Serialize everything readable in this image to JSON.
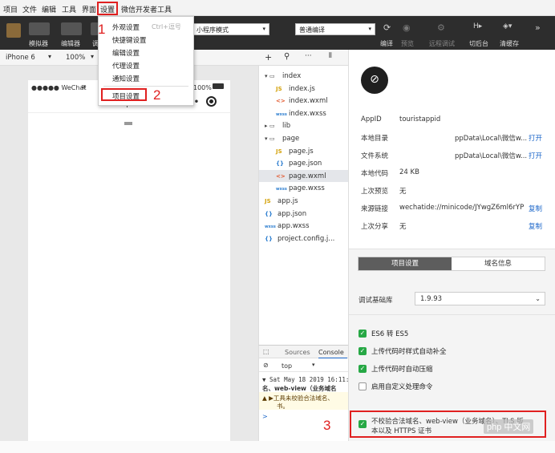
{
  "menubar": {
    "items": [
      "项目",
      "文件",
      "编辑",
      "工具",
      "界面",
      "设置",
      "微信开发者工具"
    ]
  },
  "toolbar": {
    "simulator_label": "模拟器",
    "editor_label": "编辑器",
    "debugger_label_partial": "调",
    "mode_select": "小程序模式",
    "compile_select": "普通编译",
    "compile_label": "编译",
    "preview_label": "预览",
    "remote_debug_label": "远程调试",
    "background_label": "切后台",
    "clear_cache_label": "清缓存"
  },
  "simulator": {
    "device": "iPhone 6",
    "zoom": "100%",
    "status_left": "●●●●● WeChat",
    "status_right": "100%",
    "page_title": "input",
    "more_dots": "•••"
  },
  "dropdown": {
    "items": [
      {
        "label": "外观设置",
        "shortcut": "Ctrl+逗号"
      },
      {
        "label": "快捷键设置",
        "shortcut": ""
      },
      {
        "label": "编辑设置",
        "shortcut": ""
      },
      {
        "label": "代理设置",
        "shortcut": ""
      },
      {
        "label": "通知设置",
        "shortcut": ""
      },
      {
        "label": "项目设置",
        "shortcut": ""
      }
    ]
  },
  "annotations": {
    "n1": "1",
    "n2": "2",
    "n3": "3"
  },
  "file_tree": [
    {
      "label": "index",
      "icon": "folder-open",
      "level": 0
    },
    {
      "label": "index.js",
      "icon": "JS",
      "level": 1
    },
    {
      "label": "index.wxml",
      "icon": "<>",
      "level": 1
    },
    {
      "label": "index.wxss",
      "icon": "wxss",
      "level": 1
    },
    {
      "label": "lib",
      "icon": "folder",
      "level": 0
    },
    {
      "label": "page",
      "icon": "folder-open",
      "level": 0
    },
    {
      "label": "page.js",
      "icon": "JS",
      "level": 1
    },
    {
      "label": "page.json",
      "icon": "{}",
      "level": 1
    },
    {
      "label": "page.wxml",
      "icon": "<>",
      "level": 1
    },
    {
      "label": "page.wxss",
      "icon": "wxss",
      "level": 1
    },
    {
      "label": "app.js",
      "icon": "JS",
      "level": 0
    },
    {
      "label": "app.json",
      "icon": "{}",
      "level": 0
    },
    {
      "label": "app.wxss",
      "icon": "wxss",
      "level": 0
    },
    {
      "label": "project.config.j...",
      "icon": "{}",
      "level": 0
    }
  ],
  "console": {
    "tab_sources": "Sources",
    "tab_console": "Console",
    "filter": "top",
    "line1": "▼ Sat May 18 2019 16:11:",
    "line2": "名、web-view（业务域名",
    "line3": "▲ ▶工具未校验合法域名、",
    "line4": "书。",
    "prompt": ">"
  },
  "panel": {
    "info": [
      {
        "key": "AppID",
        "value": "touristappid",
        "link": ""
      },
      {
        "key": "本地目录",
        "value": "ppData\\Local\\微信w...",
        "link": "打开"
      },
      {
        "key": "文件系统",
        "value": "ppData\\Local\\微信w...",
        "link": "打开"
      },
      {
        "key": "本地代码",
        "value": "24 KB",
        "link": ""
      },
      {
        "key": "上次预览",
        "value": "无",
        "link": ""
      },
      {
        "key": "来源链接",
        "value": "wechatide://minicode/JYwgZ6ml6rYP",
        "link": "复制"
      },
      {
        "key": "上次分享",
        "value": "无",
        "link": "复制"
      }
    ],
    "tab_project": "项目设置",
    "tab_domain": "域名信息",
    "lib_label": "调试基础库",
    "lib_version": "1.9.93",
    "options": [
      {
        "label": "ES6 转 ES5",
        "checked": true
      },
      {
        "label": "上传代码时样式自动补全",
        "checked": true
      },
      {
        "label": "上传代码时自动压缩",
        "checked": true
      },
      {
        "label": "启用自定义处理命令",
        "checked": false
      }
    ],
    "last_option_line1": "不校验合法域名、web-view（业务域名）、TLS 版",
    "last_option_line2": "本以及 HTTPS 证书"
  },
  "watermark": "php 中文网",
  "colors": {
    "annotation_red": "#e02020",
    "checkbox_green": "#27a845",
    "link_blue": "#1b66c9"
  }
}
